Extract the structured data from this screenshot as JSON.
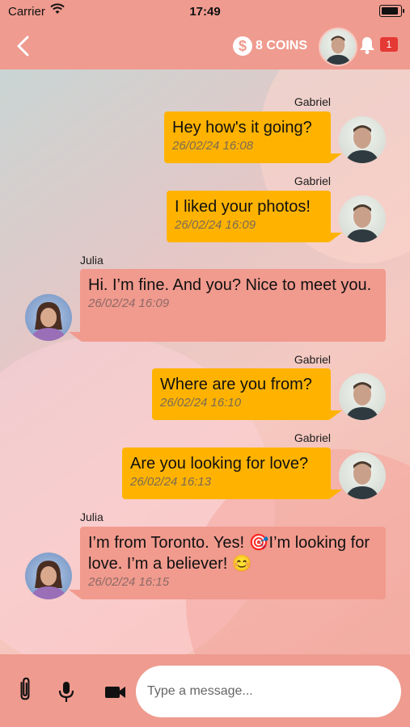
{
  "status_bar": {
    "carrier": "Carrier",
    "time": "17:49"
  },
  "navbar": {
    "coins_label": "8 COINS",
    "notification_count": "1"
  },
  "messages": [
    {
      "sender": "Gabriel",
      "direction": "outgoing",
      "text": "Hey how's it going?",
      "timestamp": "26/02/24 16:08"
    },
    {
      "sender": "Gabriel",
      "direction": "outgoing",
      "text": "I liked your photos!",
      "timestamp": "26/02/24 16:09"
    },
    {
      "sender": "Julia",
      "direction": "incoming",
      "text": "Hi. I’m fine. And you? Nice to meet you.",
      "timestamp": "26/02/24 16:09"
    },
    {
      "sender": "Gabriel",
      "direction": "outgoing",
      "text": "Where are you from?",
      "timestamp": "26/02/24 16:10"
    },
    {
      "sender": "Gabriel",
      "direction": "outgoing",
      "text": "Are you looking for love?",
      "timestamp": "26/02/24 16:13"
    },
    {
      "sender": "Julia",
      "direction": "incoming",
      "text": "I’m from Toronto. Yes! 🎯I’m looking for love. I’m a believer! 😊",
      "timestamp": "26/02/24 16:15"
    }
  ],
  "composer": {
    "placeholder": "Type a message..."
  },
  "colors": {
    "header": "#ef9b8f",
    "outgoing_bubble": "#ffb300",
    "incoming_bubble": "#f19a8e",
    "badge": "#e53935"
  },
  "icons": {
    "back": "chevron-left-icon",
    "coin": "dollar-coin-icon",
    "bell": "bell-icon",
    "attach": "paperclip-icon",
    "mic": "microphone-icon",
    "video": "video-camera-icon"
  }
}
